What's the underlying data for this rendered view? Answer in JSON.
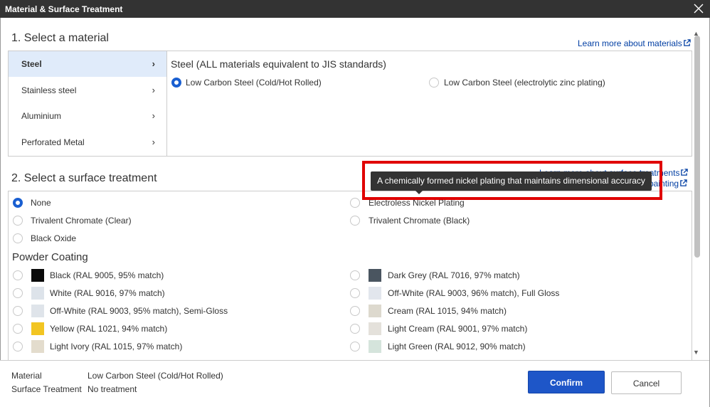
{
  "dialog": {
    "title": "Material & Surface Treatment"
  },
  "material_section": {
    "heading": "1. Select a material",
    "learn_more": "Learn more about materials",
    "categories": [
      {
        "label": "Steel",
        "active": true
      },
      {
        "label": "Stainless steel",
        "active": false
      },
      {
        "label": "Aluminium",
        "active": false
      },
      {
        "label": "Perforated Metal",
        "active": false
      }
    ],
    "group_title": "Steel (ALL materials equivalent to JIS standards)",
    "options": [
      {
        "label": "Low Carbon Steel (Cold/Hot Rolled)",
        "selected": true
      },
      {
        "label": "Low Carbon Steel (electrolytic zinc plating)",
        "selected": false
      }
    ]
  },
  "surface_section": {
    "heading": "2. Select a surface treatment",
    "learn_more_treatments": "Learn more about surface treatments",
    "learn_more_painting_partial": "painting",
    "options": [
      {
        "label": "None",
        "selected": true
      },
      {
        "label": "Electroless Nickel Plating",
        "selected": false
      },
      {
        "label": "Trivalent Chromate (Clear)",
        "selected": false
      },
      {
        "label": "Trivalent Chromate (Black)",
        "selected": false
      },
      {
        "label": "Black Oxide",
        "selected": false
      }
    ],
    "powder_coating_heading": "Powder Coating",
    "powder_colors": [
      {
        "label": "Black (RAL 9005, 95% match)",
        "color": "#0a0a0a"
      },
      {
        "label": "Dark Grey (RAL 7016, 97% match)",
        "color": "#4a5560"
      },
      {
        "label": "White (RAL 9016, 97% match)",
        "color": "#dde3ea"
      },
      {
        "label": "Off-White (RAL 9003, 96% match), Full Gloss",
        "color": "#e2e6ed"
      },
      {
        "label": "Off-White (RAL 9003, 95% match), Semi-Gloss",
        "color": "#dfe4ea"
      },
      {
        "label": "Cream (RAL 1015, 94% match)",
        "color": "#ddd9ce"
      },
      {
        "label": "Yellow (RAL 1021, 94% match)",
        "color": "#f2c522"
      },
      {
        "label": "Light Cream (RAL 9001, 97% match)",
        "color": "#e4e1db"
      },
      {
        "label": "Light Ivory (RAL 1015, 97% match)",
        "color": "#e3dccd"
      },
      {
        "label": "Light Green (RAL 9012, 90% match)",
        "color": "#d5e4dc"
      }
    ],
    "tooltip": "A chemically formed nickel plating that maintains dimensional accuracy"
  },
  "footer": {
    "material_label": "Material",
    "material_value": "Low Carbon Steel (Cold/Hot Rolled)",
    "surface_label": "Surface Treatment",
    "surface_value": "No treatment",
    "confirm": "Confirm",
    "cancel": "Cancel"
  },
  "colors": {
    "accent": "#1e56c8",
    "link": "#003ea3",
    "highlight": "#e00000"
  }
}
